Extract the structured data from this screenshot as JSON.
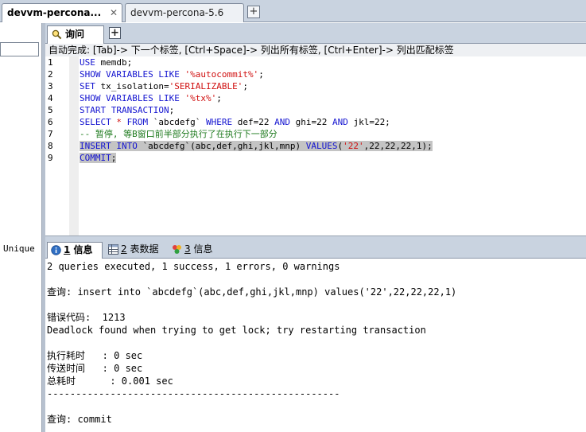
{
  "connection_tabs": [
    {
      "label": "devvm-percona...",
      "close": "✕"
    },
    {
      "label": "devvm-percona-5.6"
    }
  ],
  "new_connection": "+",
  "left_pane": {
    "unique_label": "Unique"
  },
  "query_tab": {
    "label": "询问"
  },
  "new_query": "+",
  "autocomplete_hint": "自动完成: [Tab]-> 下一个标签, [Ctrl+Space]-> 列出所有标签, [Ctrl+Enter]-> 列出匹配标签",
  "editor": {
    "line_numbers": [
      "1",
      "2",
      "3",
      "4",
      "5",
      "6",
      "7",
      "8",
      "9"
    ]
  },
  "result_tabs": [
    {
      "num": "1",
      "label": " 信息"
    },
    {
      "num": "2",
      "label": " 表数据"
    },
    {
      "num": "3",
      "label": " 信息"
    }
  ],
  "output": {
    "summary": "2 queries executed, 1 success, 1 errors, 0 warnings",
    "query1": "查询: insert into `abcdefg`(abc,def,ghi,jkl,mnp) values('22',22,22,22,1)",
    "error_code": "错误代码:  1213",
    "error_msg": "Deadlock found when trying to get lock; try restarting transaction",
    "exec_time": "执行耗时   : 0 sec",
    "transfer_time": "传送时间   : 0 sec",
    "total_time": "总耗时      : 0.001 sec",
    "separator": "---------------------------------------------------",
    "query2": "查询: commit"
  },
  "colors": {
    "keyword": "#1515d0",
    "string": "#d01010",
    "comment": "#1e7a1e",
    "selection": "#c4c4c4"
  }
}
